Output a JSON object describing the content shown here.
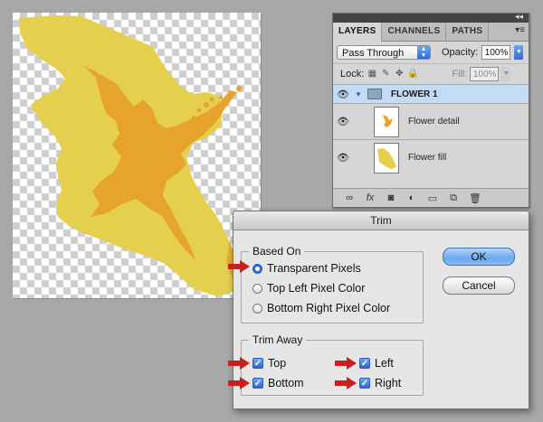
{
  "layers_panel": {
    "tabs": [
      "LAYERS",
      "CHANNELS",
      "PATHS"
    ],
    "collapse_glyph": "◂◂",
    "menu_glyph": "▾≡",
    "blend_mode": "Pass Through",
    "opacity_label": "Opacity:",
    "opacity_value": "100%",
    "lock_label": "Lock:",
    "fill_label": "Fill:",
    "fill_value": "100%",
    "group_name": "FLOWER 1",
    "layers": [
      {
        "name": "Flower detail"
      },
      {
        "name": "Flower fill"
      }
    ],
    "bottom_icons": [
      "link-icon",
      "fx-icon",
      "mask-icon",
      "adjustment-icon",
      "folder-icon",
      "new-layer-icon",
      "trash-icon"
    ]
  },
  "trim_dialog": {
    "title": "Trim",
    "based_on_label": "Based On",
    "based_on_options": [
      "Transparent Pixels",
      "Top Left Pixel Color",
      "Bottom Right Pixel Color"
    ],
    "selected_option": "Transparent Pixels",
    "trim_away_label": "Trim Away",
    "trim_top": "Top",
    "trim_bottom": "Bottom",
    "trim_left": "Left",
    "trim_right": "Right",
    "ok_label": "OK",
    "cancel_label": "Cancel"
  },
  "colors": {
    "flower_fill": "#e5cf4e",
    "flower_detail": "#e7a42c",
    "highlight_arrow": "#c8201f",
    "selection_blue": "#c4dbf6"
  }
}
